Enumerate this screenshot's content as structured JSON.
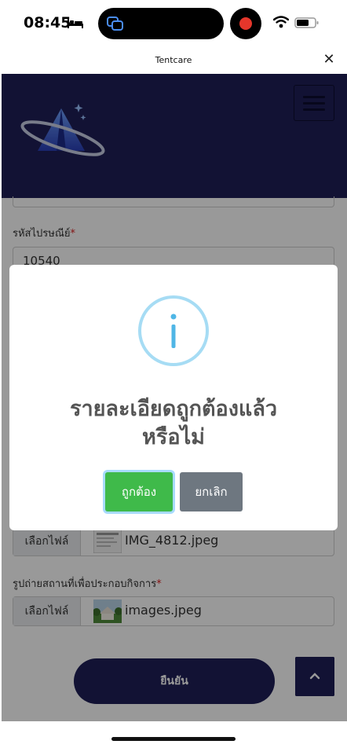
{
  "status_bar": {
    "time": "08:45",
    "icons": [
      "bed-icon",
      "screen-mirroring-icon",
      "recording-dot-icon",
      "wifi-icon",
      "battery-icon"
    ]
  },
  "browser": {
    "title": "Tentcare",
    "close_icon": "close-icon"
  },
  "site_header": {
    "logo_icon": "tent-logo-icon",
    "menu_icon": "hamburger-menu-icon"
  },
  "form": {
    "postal_code": {
      "label": "รหัสไปรษณีย์",
      "required_mark": "*",
      "value": "10540"
    },
    "file_upload_1": {
      "button_label": "เลือกไฟล์",
      "file_name": "IMG_4812.jpeg"
    },
    "file_upload_2": {
      "label": "รูปถ่ายสถานที่เพื่อประกอบกิจการ",
      "required_mark": "*",
      "button_label": "เลือกไฟล์",
      "file_name": "images.jpeg"
    },
    "submit_label": "ยืนยัน",
    "scroll_top_icon": "chevron-up-icon"
  },
  "modal": {
    "icon": "info-icon",
    "title_line1": "รายละเอียดถูกต้องแล้ว",
    "title_line2": "หรือไม่",
    "confirm_label": "ถูกต้อง",
    "cancel_label": "ยกเลิก"
  },
  "colors": {
    "brand_navy": "#1f1f57",
    "confirm_green": "#3fba4a",
    "cancel_gray": "#6e7780",
    "info_blue": "#8fd3f0",
    "required_red": "#dd2222"
  }
}
